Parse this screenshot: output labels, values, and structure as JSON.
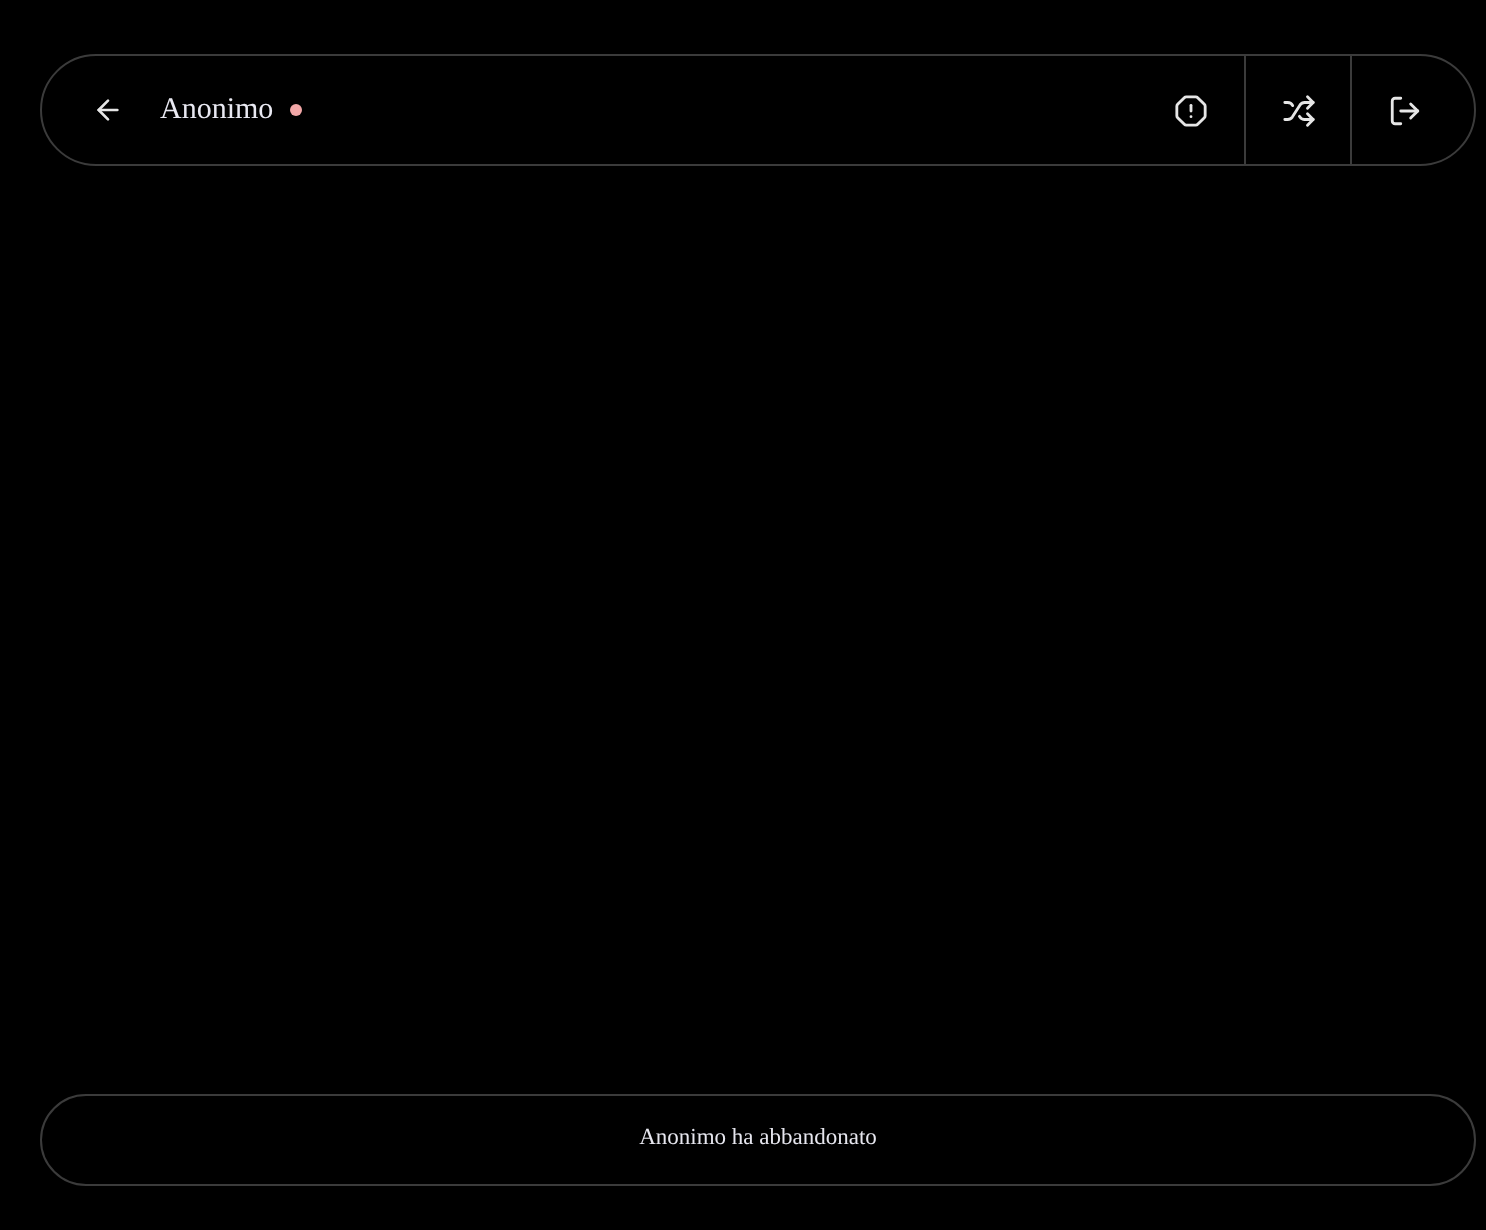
{
  "header": {
    "partner": {
      "name": "Anonimo",
      "color": "#f2a7a7"
    },
    "actions": [
      {
        "kind": "report"
      },
      {
        "kind": "shuffle"
      },
      {
        "kind": "leave"
      }
    ]
  },
  "notice": "Anonimo ha abbandonato"
}
